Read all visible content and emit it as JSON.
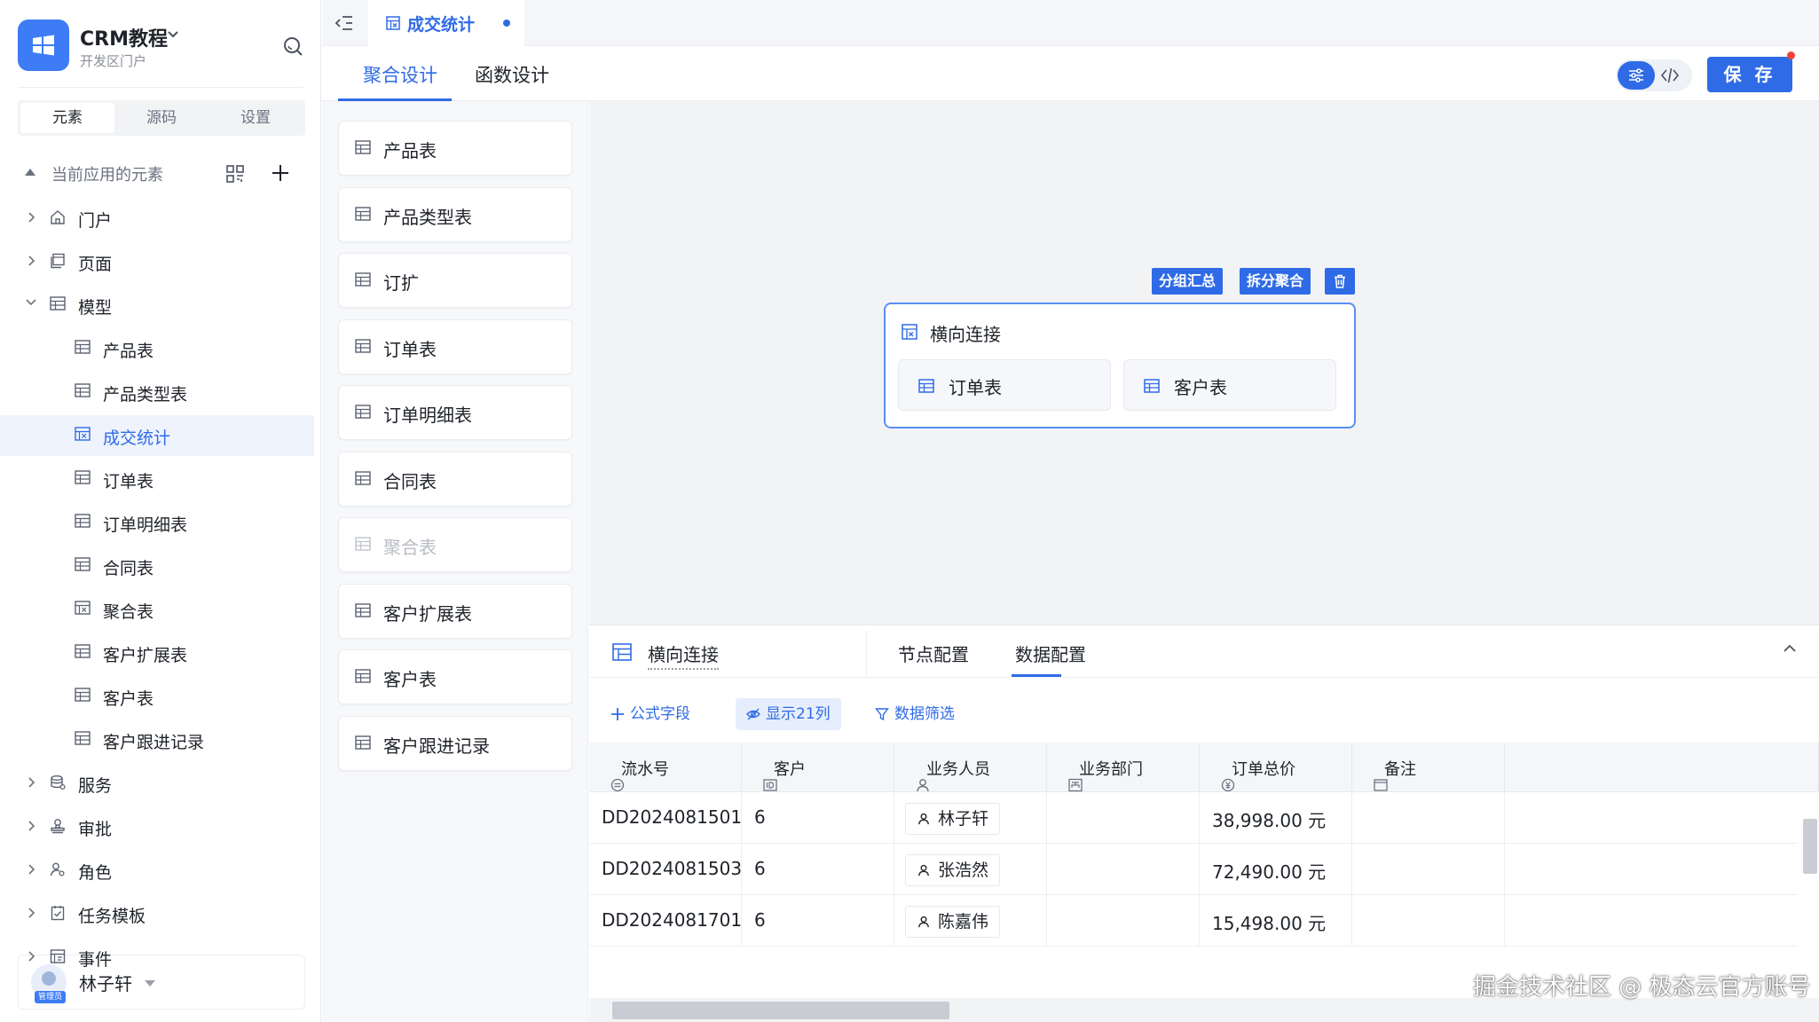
{
  "app": {
    "name": "CRM教程",
    "subtitle": "开发区门户"
  },
  "sidebar": {
    "tabs": [
      "元素",
      "源码",
      "设置"
    ],
    "section_label": "当前应用的元素",
    "tree": [
      {
        "label": "门户",
        "icon": "home-icon",
        "level": 0,
        "expandable": true
      },
      {
        "label": "页面",
        "icon": "page-icon",
        "level": 0,
        "expandable": true
      },
      {
        "label": "模型",
        "icon": "table-icon",
        "level": 0,
        "expandable": true,
        "expanded": true
      },
      {
        "label": "产品表",
        "icon": "table-icon",
        "level": 1
      },
      {
        "label": "产品类型表",
        "icon": "table-icon",
        "level": 1
      },
      {
        "label": "成交统计",
        "icon": "aggregate-icon",
        "level": 1,
        "selected": true
      },
      {
        "label": "订单表",
        "icon": "table-icon",
        "level": 1
      },
      {
        "label": "订单明细表",
        "icon": "table-icon",
        "level": 1
      },
      {
        "label": "合同表",
        "icon": "table-icon",
        "level": 1
      },
      {
        "label": "聚合表",
        "icon": "aggregate-icon",
        "level": 1
      },
      {
        "label": "客户扩展表",
        "icon": "table-icon",
        "level": 1
      },
      {
        "label": "客户表",
        "icon": "table-icon",
        "level": 1
      },
      {
        "label": "客户跟进记录",
        "icon": "table-icon",
        "level": 1
      },
      {
        "label": "服务",
        "icon": "service-icon",
        "level": 0,
        "expandable": true
      },
      {
        "label": "审批",
        "icon": "approval-icon",
        "level": 0,
        "expandable": true
      },
      {
        "label": "角色",
        "icon": "role-icon",
        "level": 0,
        "expandable": true
      },
      {
        "label": "任务模板",
        "icon": "task-icon",
        "level": 0,
        "expandable": true
      },
      {
        "label": "事件",
        "icon": "event-icon",
        "level": 0,
        "expandable": true
      }
    ],
    "user": {
      "name": "林子轩",
      "badge": "管理员"
    }
  },
  "topbar": {
    "tab_label": "成交统计"
  },
  "subbar": {
    "tabs": [
      "聚合设计",
      "函数设计"
    ],
    "save_label": "保 存"
  },
  "element_list": [
    {
      "label": "产品表",
      "disabled": false
    },
    {
      "label": "产品类型表",
      "disabled": false
    },
    {
      "label": "订扩",
      "disabled": false
    },
    {
      "label": "订单表",
      "disabled": false
    },
    {
      "label": "订单明细表",
      "disabled": false
    },
    {
      "label": "合同表",
      "disabled": false
    },
    {
      "label": "聚合表",
      "disabled": true
    },
    {
      "label": "客户扩展表",
      "disabled": false
    },
    {
      "label": "客户表",
      "disabled": false
    },
    {
      "label": "客户跟进记录",
      "disabled": false
    }
  ],
  "canvas": {
    "actions": {
      "group": "分组汇总",
      "split": "拆分聚合"
    },
    "node": {
      "title": "横向连接",
      "children": [
        "订单表",
        "客户表"
      ]
    }
  },
  "panel": {
    "title": "横向连接",
    "tabs": [
      "节点配置",
      "数据配置"
    ],
    "tools": {
      "formula": "公式字段",
      "show": "显示21列",
      "filter": "数据筛选"
    },
    "columns": [
      {
        "label": "流水号",
        "icon": "serial-icon"
      },
      {
        "label": "客户",
        "icon": "id-icon"
      },
      {
        "label": "业务人员",
        "icon": "user-icon"
      },
      {
        "label": "业务部门",
        "icon": "department-icon"
      },
      {
        "label": "订单总价",
        "icon": "currency-icon"
      },
      {
        "label": "备注",
        "icon": "note-icon"
      }
    ],
    "rows": [
      {
        "serial": "DD2024081501",
        "customer": "6",
        "staff": "林子轩",
        "dept": "",
        "total": "38,998.00 元",
        "note": ""
      },
      {
        "serial": "DD2024081503",
        "customer": "6",
        "staff": "张浩然",
        "dept": "",
        "total": "72,490.00 元",
        "note": ""
      },
      {
        "serial": "DD2024081701",
        "customer": "6",
        "staff": "陈嘉伟",
        "dept": "",
        "total": "15,498.00 元",
        "note": ""
      }
    ]
  },
  "watermark": "掘金技术社区 @ 极态云官方账号",
  "colors": {
    "accent": "#2f6be6",
    "selected_bg": "#eef3fd",
    "canvas_bg": "#f2f3f5"
  }
}
